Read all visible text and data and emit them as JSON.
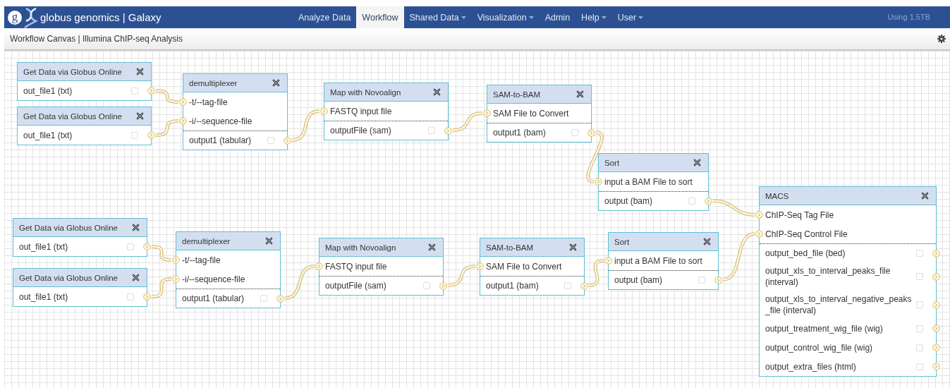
{
  "brand": {
    "logo_letter": "g",
    "title": "globus genomics | Galaxy"
  },
  "nav": [
    {
      "label": "Analyze Data",
      "selected": false,
      "dropdown": false
    },
    {
      "label": "Workflow",
      "selected": true,
      "dropdown": false
    },
    {
      "label": "Shared Data",
      "selected": false,
      "dropdown": true
    },
    {
      "label": "Visualization",
      "selected": false,
      "dropdown": true
    },
    {
      "label": "Admin",
      "selected": false,
      "dropdown": false
    },
    {
      "label": "Help",
      "selected": false,
      "dropdown": true
    },
    {
      "label": "User",
      "selected": false,
      "dropdown": true
    }
  ],
  "quota": "Using 1.5TB",
  "canvas_title": "Workflow Canvas | Illumina ChIP-seq Analysis",
  "nodes": [
    {
      "title": "Get Data via Globus Online",
      "outputs": [
        {
          "label": "out_file1 (txt)",
          "checked": false
        }
      ]
    },
    {
      "title": "Get Data via Globus Online",
      "outputs": [
        {
          "label": "out_file1 (txt)",
          "checked": false
        }
      ]
    },
    {
      "title": "demultiplexer",
      "inputs": [
        "-t/--tag-file",
        "-i/--sequence-file"
      ],
      "outputs": [
        {
          "label": "output1 (tabular)",
          "checked": false
        }
      ]
    },
    {
      "title": "Map with Novoalign",
      "inputs": [
        "FASTQ input file"
      ],
      "outputs": [
        {
          "label": "outputFile (sam)",
          "checked": false
        }
      ]
    },
    {
      "title": "SAM-to-BAM",
      "inputs": [
        "SAM File to Convert"
      ],
      "outputs": [
        {
          "label": "output1 (bam)",
          "checked": false
        }
      ]
    },
    {
      "title": "Sort",
      "inputs": [
        "input a BAM File to sort"
      ],
      "outputs": [
        {
          "label": "output (bam)",
          "checked": false
        }
      ]
    },
    {
      "title": "Get Data via Globus Online",
      "outputs": [
        {
          "label": "out_file1 (txt)",
          "checked": false
        }
      ]
    },
    {
      "title": "Get Data via Globus Online",
      "outputs": [
        {
          "label": "out_file1 (txt)",
          "checked": false
        }
      ]
    },
    {
      "title": "demultiplexer",
      "inputs": [
        "-t/--tag-file",
        "-i/--sequence-file"
      ],
      "outputs": [
        {
          "label": "output1 (tabular)",
          "checked": false
        }
      ]
    },
    {
      "title": "Map with Novoalign",
      "inputs": [
        "FASTQ input file"
      ],
      "outputs": [
        {
          "label": "outputFile (sam)",
          "checked": false
        }
      ]
    },
    {
      "title": "SAM-to-BAM",
      "inputs": [
        "SAM File to Convert"
      ],
      "outputs": [
        {
          "label": "output1 (bam)",
          "checked": false
        }
      ]
    },
    {
      "title": "Sort",
      "inputs": [
        "input a BAM File to sort"
      ],
      "outputs": [
        {
          "label": "output (bam)",
          "checked": false
        }
      ]
    },
    {
      "title": "MACS",
      "inputs": [
        "ChIP-Seq Tag File",
        "ChIP-Seq Control File"
      ],
      "outputs": [
        {
          "label": "output_bed_file (bed)",
          "checked": false
        },
        {
          "label": "output_xls_to_interval_peaks_file (interval)",
          "checked": false
        },
        {
          "label": "output_xls_to_interval_negative_peaks_file (interval)",
          "checked": false
        },
        {
          "label": "output_treatment_wig_file (wig)",
          "checked": false
        },
        {
          "label": "output_control_wig_file (wig)",
          "checked": false
        },
        {
          "label": "output_extra_files (html)",
          "checked": false
        }
      ]
    }
  ]
}
